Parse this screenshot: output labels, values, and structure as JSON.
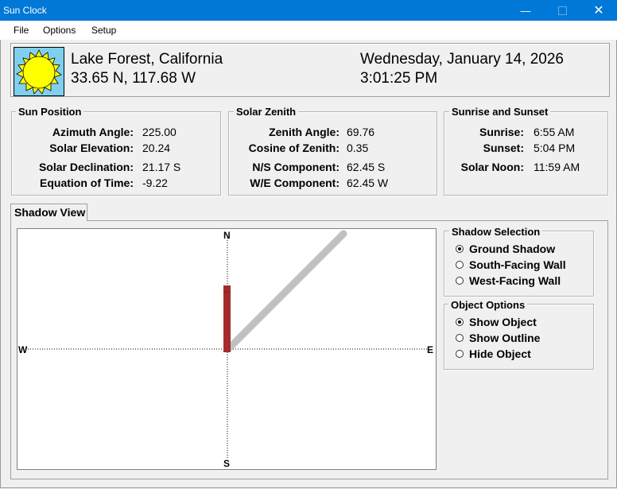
{
  "window": {
    "title": "Sun Clock"
  },
  "menu": {
    "items": [
      "File",
      "Options",
      "Setup"
    ]
  },
  "header": {
    "location": "Lake Forest, California",
    "coordinates": "33.65 N, 117.68 W",
    "date": "Wednesday, January 14, 2026",
    "time": "3:01:25 PM"
  },
  "sun_position": {
    "title": "Sun Position",
    "azimuth_label": "Azimuth Angle:",
    "azimuth": "225.00",
    "elevation_label": "Solar Elevation:",
    "elevation": "20.24",
    "declination_label": "Solar Declination:",
    "declination": "21.17 S",
    "eot_label": "Equation of Time:",
    "eot": "-9.22"
  },
  "solar_zenith": {
    "title": "Solar Zenith",
    "zenith_label": "Zenith Angle:",
    "zenith": "69.76",
    "cosine_label": "Cosine of Zenith:",
    "cosine": "0.35",
    "ns_label": "N/S Component:",
    "ns": "62.45 S",
    "we_label": "W/E Component:",
    "we": "62.45 W"
  },
  "sunrise_sunset": {
    "title": "Sunrise and Sunset",
    "sunrise_label": "Sunrise:",
    "sunrise": "6:55 AM",
    "sunset_label": "Sunset:",
    "sunset": "5:04 PM",
    "noon_label": "Solar Noon:",
    "noon": "11:59 AM"
  },
  "tab": {
    "label": "Shadow View"
  },
  "compass": {
    "n": "N",
    "s": "S",
    "e": "E",
    "w": "W"
  },
  "shadow_selection": {
    "title": "Shadow Selection",
    "options": [
      "Ground Shadow",
      "South-Facing Wall",
      "West-Facing Wall"
    ],
    "selected": "Ground Shadow"
  },
  "object_options": {
    "title": "Object Options",
    "options": [
      "Show Object",
      "Show Outline",
      "Hide Object"
    ],
    "selected": "Show Object"
  },
  "colors": {
    "titlebar": "#0078d7",
    "sun_sky": "#80cfef",
    "sun": "#ffff00",
    "object": "#a52a2a",
    "shadow": "#c0c0c0"
  },
  "icons": [
    "sun-icon",
    "minimize-icon",
    "maximize-icon",
    "close-icon"
  ]
}
